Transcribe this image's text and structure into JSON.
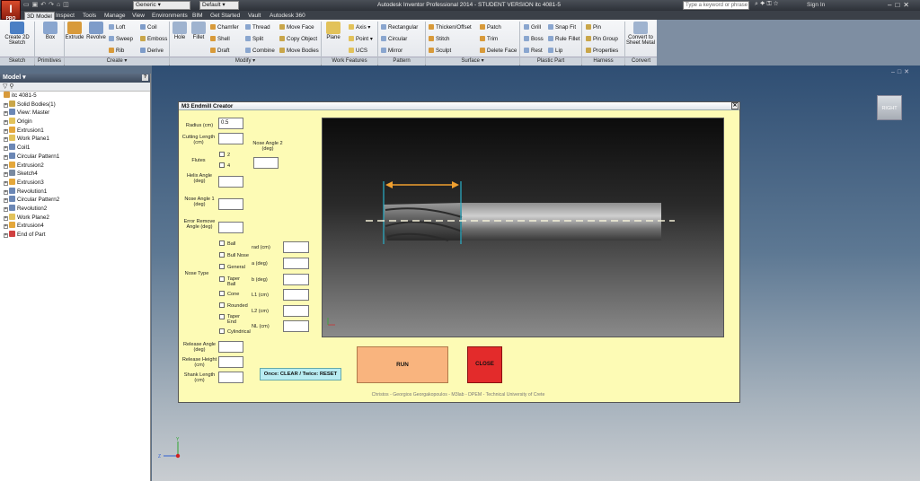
{
  "titlebar": {
    "logo_letter": "I",
    "logo_sub": "PRO",
    "appearance_select": "Generic",
    "material_select": "Default",
    "app_title": "Autodesk Inventor Professional 2014 - STUDENT VERSION   itc 4081-5",
    "search_placeholder": "Type a keyword or phrase",
    "sign_in": "Sign In"
  },
  "ribbon_tabs": [
    "3D Model",
    "Inspect",
    "Tools",
    "Manage",
    "View",
    "Environments",
    "BIM",
    "Get Started",
    "Vault",
    "Autodesk 360"
  ],
  "ribbon": {
    "groups": {
      "sketch": "Sketch",
      "primitives": "Primitives",
      "create": "Create ▾",
      "modify": "Modify ▾",
      "work_features": "Work Features",
      "pattern": "Pattern",
      "surface": "Surface ▾",
      "plastic_part": "Plastic Part",
      "harness": "Harness",
      "convert": "Convert"
    },
    "big": {
      "create_sketch": "Create 2D Sketch",
      "box": "Box",
      "extrude": "Extrude",
      "revolve": "Revolve",
      "hole": "Hole",
      "fillet": "Fillet",
      "plane": "Plane",
      "convert_sheet": "Convert to Sheet Metal"
    },
    "small": {
      "loft": "Loft",
      "sweep": "Sweep",
      "rib": "Rib",
      "coil": "Coil",
      "emboss": "Emboss",
      "derive": "Derive",
      "chamfer": "Chamfer",
      "shell": "Shell",
      "draft": "Draft",
      "thread": "Thread",
      "split": "Split",
      "combine": "Combine",
      "move_face": "Move Face",
      "copy_object": "Copy Object",
      "move_bodies": "Move Bodies",
      "axis": "Axis",
      "point": "Point",
      "ucs": "UCS",
      "rectangular": "Rectangular",
      "circular": "Circular",
      "mirror": "Mirror",
      "thicken": "Thicken/Offset",
      "stitch": "Stitch",
      "sculpt": "Sculpt",
      "patch": "Patch",
      "trim": "Trim",
      "delete_face": "Delete Face",
      "grill": "Grill",
      "boss": "Boss",
      "rest": "Rest",
      "snap_fit": "Snap Fit",
      "rule_fillet": "Rule Fillet",
      "lip": "Lip",
      "pin": "Pin",
      "pin_group": "Pin Group",
      "properties": "Properties"
    }
  },
  "browser": {
    "title": "Model ▾",
    "help": "?",
    "items": [
      {
        "label": "itc 4081-5",
        "color": "#d89a3a"
      },
      {
        "label": "Solid Bodies(1)",
        "color": "#c9a64a"
      },
      {
        "label": "View: Master",
        "color": "#6b87b5"
      },
      {
        "label": "Origin",
        "color": "#e2c25a"
      },
      {
        "label": "Extrusion1",
        "color": "#e4a73b"
      },
      {
        "label": "Work Plane1",
        "color": "#e2c25a"
      },
      {
        "label": "Coil1",
        "color": "#6b87b5"
      },
      {
        "label": "Circular Pattern1",
        "color": "#6b87b5"
      },
      {
        "label": "Extrusion2",
        "color": "#e4a73b"
      },
      {
        "label": "Sketch4",
        "color": "#7a8aa0"
      },
      {
        "label": "Extrusion3",
        "color": "#e4a73b"
      },
      {
        "label": "Revolution1",
        "color": "#6b87b5"
      },
      {
        "label": "Circular Pattern2",
        "color": "#6b87b5"
      },
      {
        "label": "Revolution2",
        "color": "#6b87b5"
      },
      {
        "label": "Work Plane2",
        "color": "#e2c25a"
      },
      {
        "label": "Extrusion4",
        "color": "#e4a73b"
      },
      {
        "label": "End of Part",
        "color": "#d04040"
      }
    ]
  },
  "viewcube": {
    "label": "RIGHT"
  },
  "dialog": {
    "title": "M3 Endmill Creator",
    "close_glyph": "✕",
    "fields": {
      "radius": {
        "label": "Radius (cm)",
        "value": "0.5"
      },
      "cutting_length": {
        "label": "Cutting Length (cm)",
        "value": ""
      },
      "flutes": {
        "label": "Flutes",
        "options": [
          "2",
          "4"
        ]
      },
      "helix_angle": {
        "label": "Helix Angle (deg)",
        "value": ""
      },
      "nose_angle_1": {
        "label": "Nose Angle 1 (deg)",
        "value": ""
      },
      "nose_angle_2": {
        "label": "Nose Angle 2 (deg)",
        "value": ""
      },
      "error_remove_angle": {
        "label": "Error Remove Angle (deg)",
        "value": ""
      },
      "nose_type": {
        "label": "Nose Type",
        "options": [
          "Ball",
          "Bull Nose",
          "General",
          "Taper Ball",
          "Cone",
          "Rounded",
          "Taper End",
          "Cylindrical"
        ]
      },
      "rad": {
        "label": "rad (cm)",
        "value": ""
      },
      "a_deg": {
        "label": "a (deg)",
        "value": ""
      },
      "b_deg": {
        "label": "b (deg)",
        "value": ""
      },
      "l1": {
        "label": "L1 (cm)",
        "value": ""
      },
      "l2": {
        "label": "L2 (cm)",
        "value": ""
      },
      "nl": {
        "label": "NL (cm)",
        "value": ""
      },
      "release_angle": {
        "label": "Release Angle (deg)",
        "value": ""
      },
      "release_height": {
        "label": "Release Height (cm)",
        "value": ""
      },
      "shank_length": {
        "label": "Shank Length (cm)",
        "value": ""
      }
    },
    "buttons": {
      "run": "RUN",
      "close": "CLOSE",
      "clear": "Once: CLEAR / Twice: RESET"
    },
    "credits": "Christos - Georgios Georgakopoulos - M3lab - DPEM - Technical University of Crete"
  },
  "colors": {
    "dialog_bg": "#fdfbb5",
    "run": "#f9b47e",
    "close": "#e32b2b",
    "clear": "#b8ecf2",
    "dimension_arrow": "#f0a030"
  }
}
